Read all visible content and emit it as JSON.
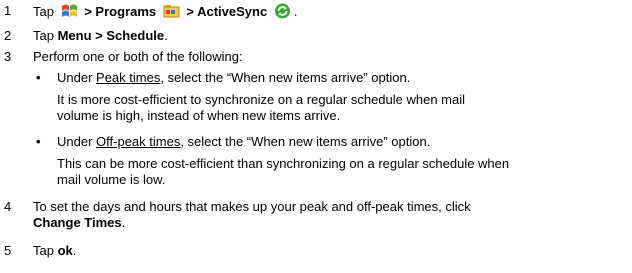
{
  "steps": [
    {
      "num": "1",
      "pre": "Tap",
      "programs": "> Programs",
      "activesync": "> ActiveSync",
      "end": ".",
      "icons": [
        "start-menu-icon",
        "programs-folder-icon",
        "activesync-icon"
      ]
    },
    {
      "num": "2",
      "pre": "Tap ",
      "bold": "Menu > Schedule",
      "end": "."
    },
    {
      "num": "3",
      "text": "Perform one or both of the following:"
    },
    {
      "num": "4",
      "line1": "To set the days and hours that makes up your peak and off-peak times, click",
      "bold": "Change Times",
      "end": "."
    },
    {
      "num": "5",
      "pre": "Tap ",
      "bold": "ok",
      "end": "."
    }
  ],
  "bullets": [
    {
      "bullet": "•",
      "pre": "Under ",
      "underlined": "Peak times",
      "post": ", select the “When new items arrive” option.",
      "note_line1": "It is more cost-efficient to synchronize on a regular schedule when mail",
      "note_line2": "volume is high, instead of when new items arrive."
    },
    {
      "bullet": "•",
      "pre": "Under ",
      "underlined": "Off-peak times",
      "post": ", select the “When new items arrive” option.",
      "note_line1": "This can be more cost-efficient than synchronizing on a regular schedule when",
      "note_line2": "mail volume is low."
    }
  ]
}
